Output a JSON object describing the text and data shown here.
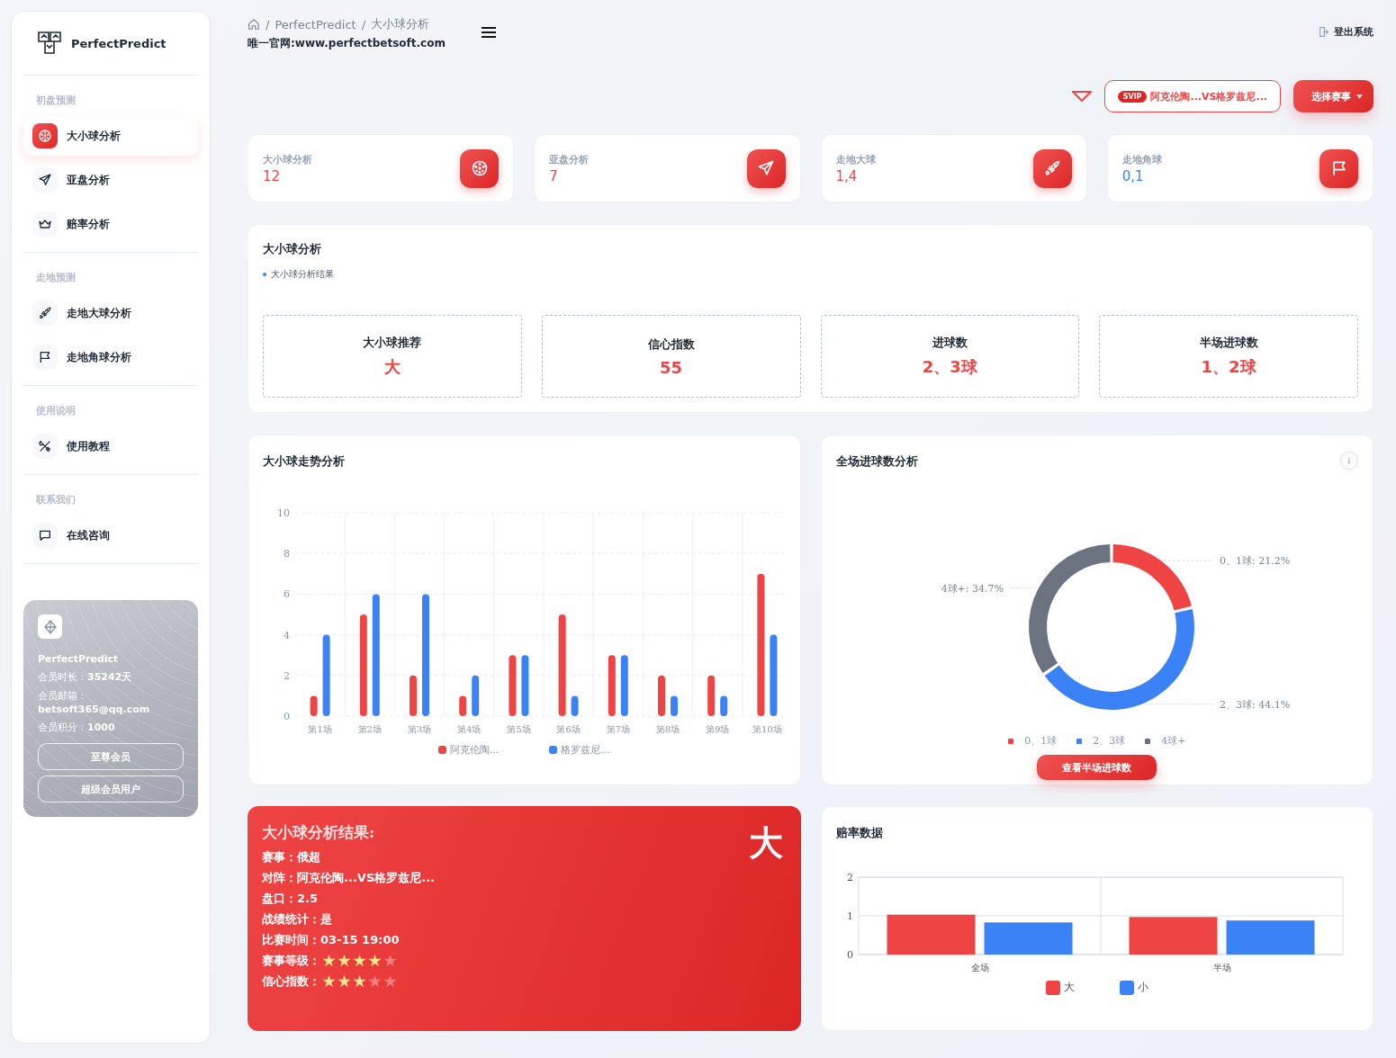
{
  "brand": {
    "name": "PerfectPredict"
  },
  "sidebar": {
    "sections": [
      {
        "title": "初盘预测",
        "items": [
          {
            "label": "大小球分析",
            "selected": true
          },
          {
            "label": "亚盘分析",
            "selected": false
          },
          {
            "label": "赔率分析",
            "selected": false
          }
        ]
      },
      {
        "title": "走地预测",
        "items": [
          {
            "label": "走地大球分析",
            "selected": false
          },
          {
            "label": "走地角球分析",
            "selected": false
          }
        ]
      },
      {
        "title": "使用说明",
        "items": [
          {
            "label": "使用教程",
            "selected": false
          }
        ]
      },
      {
        "title": "联系我们",
        "items": [
          {
            "label": "在线咨询",
            "selected": false
          }
        ]
      }
    ]
  },
  "member_card": {
    "name": "PerfectPredict",
    "duration": "会员时长：**35242天**",
    "email_label": "会员邮箱：",
    "email": "betsoft365@qq.com",
    "points": "会员积分：**1000**",
    "buttons": [
      "至尊会员",
      "超级会员用户"
    ]
  },
  "header": {
    "breadcrumb": [
      "/",
      "PerfectPredict",
      "/",
      "大小球分析"
    ],
    "site": "唯一官网:www.perfectbetsoft.com",
    "logout": "登出系统",
    "match_badge": "SVIP",
    "match": "阿克伦陶...VS格罗兹尼...",
    "select_button": "选择赛事"
  },
  "stats": [
    {
      "label": "大小球分析",
      "value": "12",
      "color": "#ef4444"
    },
    {
      "label": "亚盘分析",
      "value": "7",
      "color": "#ef4444"
    },
    {
      "label": "走地大球",
      "value": "1,4",
      "color": "#ef4444"
    },
    {
      "label": "走地角球",
      "value": "0,1",
      "color": "#3b82f6"
    }
  ],
  "analysis": {
    "title": "大小球分析",
    "subtitle": "大小球分析结果",
    "boxes": [
      {
        "label": "大小球推荐",
        "value": "大"
      },
      {
        "label": "信心指数",
        "value": "55"
      },
      {
        "label": "进球数",
        "value": "2、3球"
      },
      {
        "label": "半场进球数",
        "value": "1、2球"
      }
    ]
  },
  "trend": {
    "title": "大小球走势分析",
    "chart_data": {
      "type": "bar",
      "grid": true,
      "categories": [
        "第1场",
        "第2场",
        "第3场",
        "第4场",
        "第5场",
        "第6场",
        "第7场",
        "第8场",
        "第9场",
        "第10场"
      ],
      "ylim": [
        0,
        10
      ],
      "yticks": [
        0,
        2,
        4,
        6,
        8,
        10
      ],
      "series": [
        {
          "name": "阿克伦陶...",
          "color": "#ef4444",
          "values": [
            1,
            5,
            2,
            1,
            3,
            5,
            3,
            2,
            2,
            7
          ]
        },
        {
          "name": "格罗兹尼...",
          "color": "#3b82f6",
          "values": [
            4,
            6,
            6,
            2,
            3,
            1,
            3,
            1,
            1,
            4
          ]
        }
      ]
    }
  },
  "goals": {
    "title": "全场进球数分析",
    "info": "i",
    "button": "查看半场进球数",
    "chart_data": {
      "type": "donut",
      "categories": [
        "0、1球",
        "2、3球",
        "4球+"
      ],
      "values": [
        21.2,
        44.1,
        34.7
      ]
    },
    "slices": [
      {
        "color": "#ef4444",
        "label": "0、1球: 21.2%"
      },
      {
        "color": "#3b82f6",
        "label": "2、3球: 44.1%"
      },
      {
        "color": "#6b7280",
        "label": "4球+: 34.7%"
      }
    ]
  },
  "result": {
    "title": "大小球分析结果:",
    "big": "大",
    "lines": [
      {
        "kind": "text",
        "text": "赛事：俄超"
      },
      {
        "kind": "text",
        "text": "对阵：阿克伦陶...VS格罗兹尼..."
      },
      {
        "kind": "text",
        "text": "盘口：2.5"
      },
      {
        "kind": "text",
        "text": "战绩统计：是"
      },
      {
        "kind": "text",
        "text": "比赛时间：03-15 19:00"
      },
      {
        "kind": "stars",
        "text": "赛事等级：",
        "stars": 4
      },
      {
        "kind": "stars",
        "text": "信心指数：",
        "stars": 3
      }
    ]
  },
  "odds": {
    "title": "赔率数据",
    "chart_data": {
      "type": "bar",
      "grid": true,
      "categories": [
        "全场",
        "半场"
      ],
      "ylim": [
        0,
        2
      ],
      "yticks": [
        0,
        1,
        2
      ],
      "series": [
        {
          "name": "大",
          "color": "#ef4444",
          "values": [
            1.03,
            0.97
          ]
        },
        {
          "name": "小",
          "color": "#3b82f6",
          "values": [
            0.83,
            0.88
          ]
        }
      ]
    }
  }
}
